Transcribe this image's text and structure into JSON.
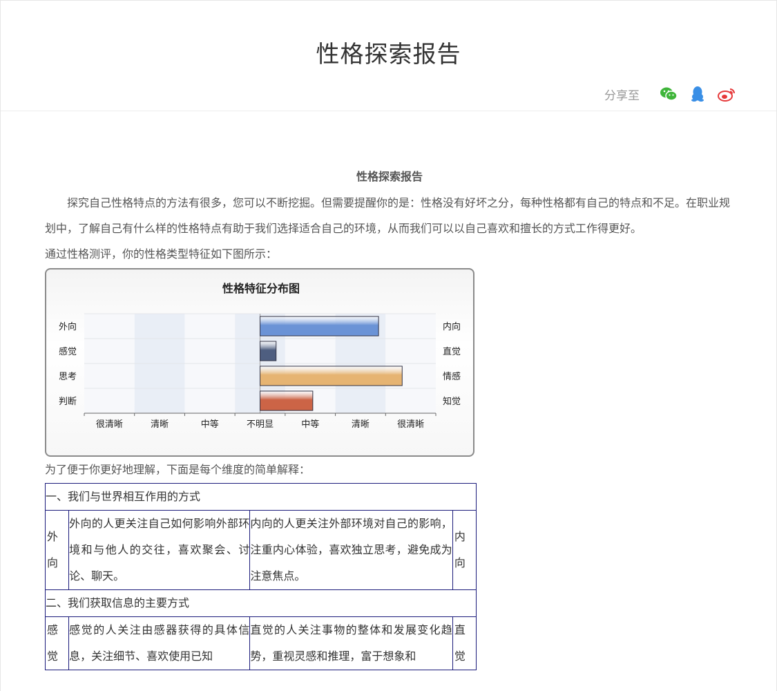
{
  "header": {
    "title": "性格探索报告",
    "share_label": "分享至",
    "share_icons": [
      "wechat-icon",
      "qq-icon",
      "weibo-icon"
    ]
  },
  "content": {
    "heading": "性格探索报告",
    "intro": "探究自己性格特点的方法有很多，您可以不断挖掘。但需要提醒你的是：性格没有好坏之分，每种性格都有自己的特点和不足。在职业规划中，了解自己有什么样的性格特点有助于我们选择适合自己的环境，从而我们可以以自己喜欢和擅长的方式工作得更好。",
    "chart_intro": "通过性格测评，你的性格类型特征如下图所示：",
    "table_intro": "为了便于你更好地理解，下面是每个维度的简单解释："
  },
  "chart_data": {
    "type": "bar",
    "title": "性格特征分布图",
    "left_labels": [
      "外向",
      "感觉",
      "思考",
      "判断"
    ],
    "right_labels": [
      "内向",
      "直觉",
      "情感",
      "知觉"
    ],
    "tick_labels": [
      "很清晰",
      "清晰",
      "中等",
      "不明显",
      "中等",
      "清晰",
      "很清晰"
    ],
    "xlim": [
      -3.5,
      3.5
    ],
    "values": [
      2.36,
      0.32,
      2.83,
      1.05
    ],
    "colors": [
      "#6b93d6",
      "#4e5e80",
      "#e6b472",
      "#cc6446"
    ],
    "grid": true
  },
  "table": {
    "sections": [
      {
        "title": "一、我们与世界相互作用的方式",
        "left_label": "外向",
        "left_desc": "外向的人更关注自己如何影响外部环境和与他人的交往，喜欢聚会、讨论、聊天。",
        "right_desc": "内向的人更关注外部环境对自己的影响，注重内心体验，喜欢独立思考，避免成为注意焦点。",
        "right_label": "内向"
      },
      {
        "title": "二、我们获取信息的主要方式",
        "left_label": "感觉",
        "left_desc": "感觉的人关注由感器获得的具体信息，关注细节、喜欢使用已知",
        "right_desc": "直觉的人关注事物的整体和发展变化趋势，重视灵感和推理，富于想象和",
        "right_label": "直觉"
      }
    ]
  }
}
